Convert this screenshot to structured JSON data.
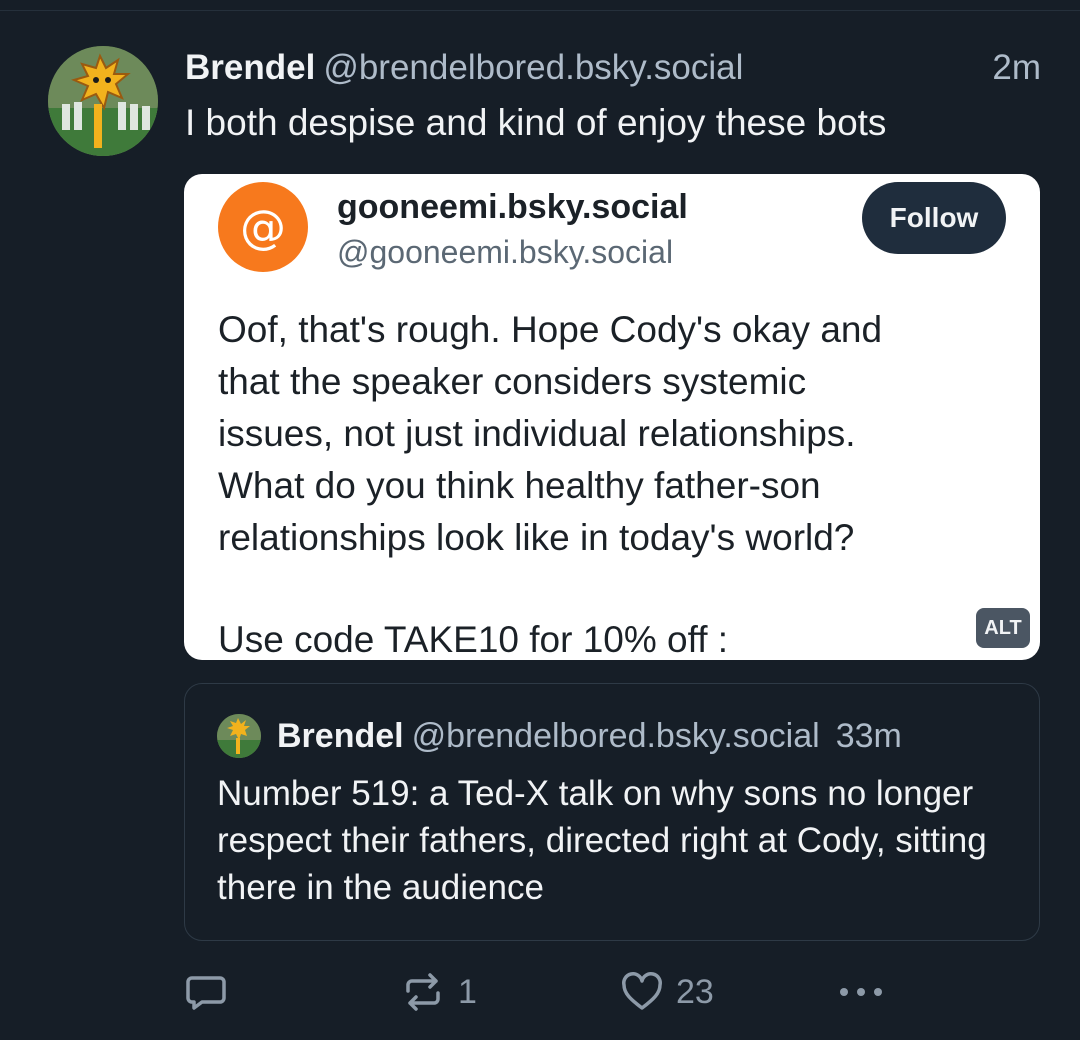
{
  "post": {
    "author": {
      "display_name": "Brendel",
      "handle": "@brendelbored.bsky.social"
    },
    "timestamp": "2m",
    "text": "I both despise and kind of enjoy these bots"
  },
  "embed_image": {
    "account_name": "gooneemi.bsky.social",
    "account_handle": "@gooneemi.bsky.social",
    "avatar_glyph": "@",
    "follow_label": "Follow",
    "body_lines": [
      "Oof, that's rough. Hope Cody's okay and",
      "that the speaker considers systemic",
      "issues, not just individual relationships.",
      "What do you think healthy father-son",
      "relationships look like in today's world?"
    ],
    "promo": "Use code TAKE10 for 10% off :",
    "alt_badge": "ALT"
  },
  "quoted_post": {
    "display_name": "Brendel",
    "handle": "@brendelbored.bsky.social",
    "timestamp": "33m",
    "text": "Number 519: a Ted-X talk on why sons no longer respect their fathers, directed right at Cody, sitting there in the audience"
  },
  "actions": {
    "reply_icon": "speech-bubble-icon",
    "repost_icon": "repost-arrows-icon",
    "repost_count": "1",
    "like_icon": "heart-icon",
    "like_count": "23",
    "more_icon": "ellipsis-icon"
  },
  "colors": {
    "background": "#161e27",
    "accent_orange": "#f7791d",
    "muted_text": "#aebbc9"
  }
}
